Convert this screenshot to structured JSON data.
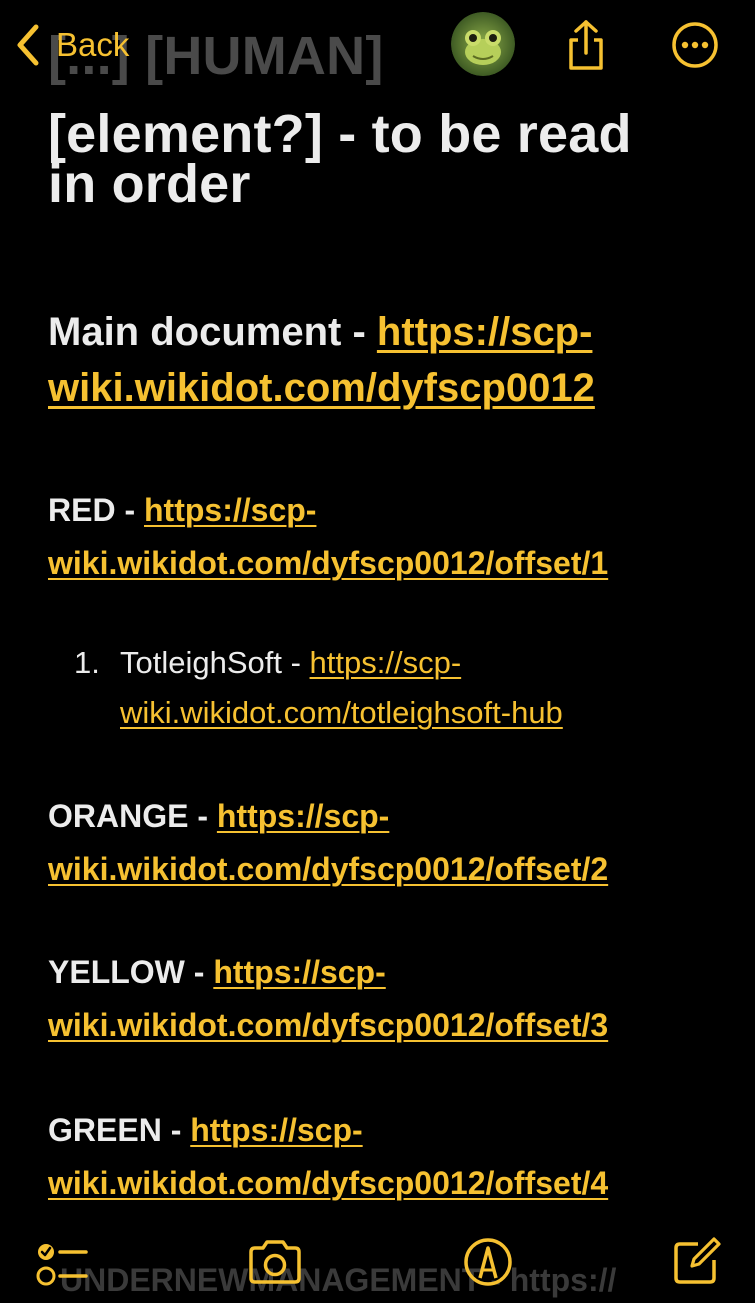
{
  "colors": {
    "accent": "#f6c131",
    "text": "#ececec",
    "background": "#000000"
  },
  "nav": {
    "back_label": "Back",
    "icons": {
      "back": "chevron-left-icon",
      "avatar": "frog-avatar",
      "share": "share-icon",
      "more": "ellipsis-circle-icon"
    }
  },
  "note": {
    "title_partial": "[...] [HUMAN]",
    "title_line2": "[element?] - to be read",
    "title_line3": "in order",
    "main": {
      "label": "Main document - ",
      "link": "https://scp-wiki.wikidot.com/dyfscp0012"
    },
    "sections": {
      "red": {
        "label": "RED - ",
        "link": "https://scp-wiki.wikidot.com/dyfscp0012/offset/1"
      },
      "orange": {
        "label": "ORANGE - ",
        "link": "https://scp-wiki.wikidot.com/dyfscp0012/offset/2"
      },
      "yellow": {
        "label": "YELLOW - ",
        "link": "https://scp-wiki.wikidot.com/dyfscp0012/offset/3"
      },
      "green": {
        "label": "GREEN - ",
        "link": "https://scp-wiki.wikidot.com/dyfscp0012/offset/4"
      }
    },
    "list": [
      {
        "number": "1.",
        "label": "TotleighSoft - ",
        "link": "https://scp-wiki.wikidot.com/totleighsoft-hub"
      }
    ],
    "hidden_row": "UNDERNEWMANAGEMENT - https://"
  },
  "toolbar": {
    "icons": [
      "checklist-icon",
      "camera-icon",
      "markup-pen-icon",
      "compose-icon"
    ]
  }
}
